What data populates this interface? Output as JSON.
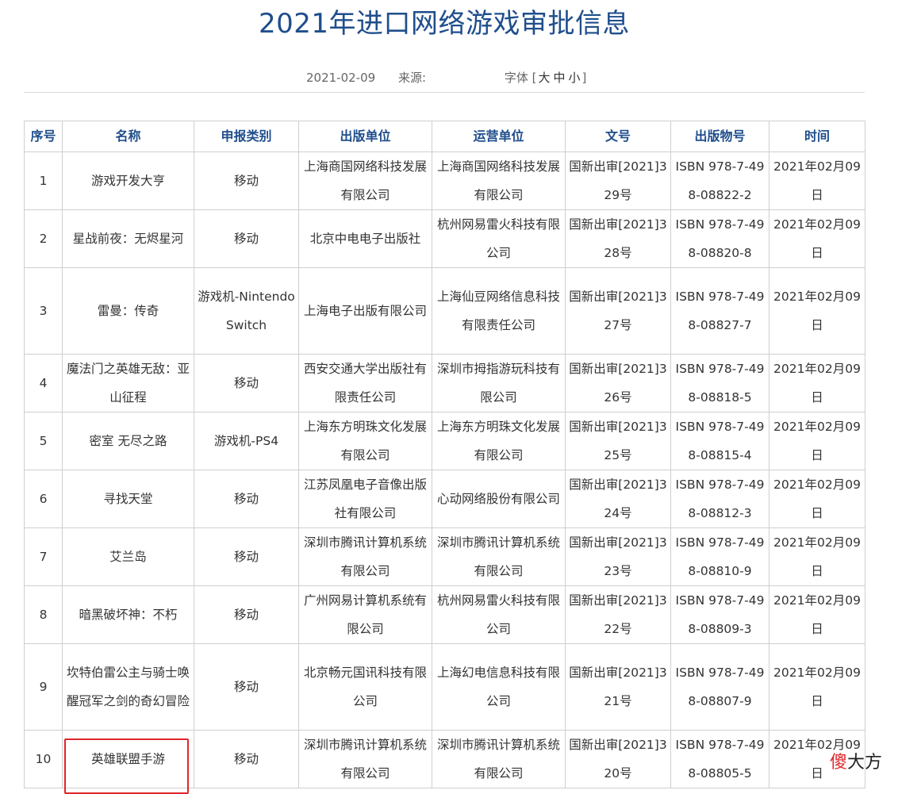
{
  "article": {
    "title": "2021年进口网络游戏审批信息",
    "date": "2021-02-09",
    "source_label": "来源:",
    "font_label": "字体",
    "font_open": "[",
    "font_large": "大",
    "font_medium": "中",
    "font_small": "小",
    "font_close": "]"
  },
  "table": {
    "headers": [
      "序号",
      "名称",
      "申报类别",
      "出版单位",
      "运营单位",
      "文号",
      "出版物号",
      "时间"
    ],
    "rows": [
      {
        "no": "1",
        "name": "游戏开发大亨",
        "category": "移动",
        "publisher": "上海商国网络科技发展有限公司",
        "operator": "上海商国网络科技发展有限公司",
        "doc_no": "国新出审[2021]329号",
        "isbn": "ISBN 978-7-498-08822-2",
        "date": "2021年02月09日"
      },
      {
        "no": "2",
        "name": "星战前夜：无烬星河",
        "category": "移动",
        "publisher": "北京中电电子出版社",
        "operator": "杭州网易雷火科技有限公司",
        "doc_no": "国新出审[2021]328号",
        "isbn": "ISBN 978-7-498-08820-8",
        "date": "2021年02月09日"
      },
      {
        "no": "3",
        "name": "雷曼：传奇",
        "category": "游戏机-Nintendo Switch",
        "publisher": "上海电子出版有限公司",
        "operator": "上海仙豆网络信息科技有限责任公司",
        "doc_no": "国新出审[2021]327号",
        "isbn": "ISBN 978-7-498-08827-7",
        "date": "2021年02月09日"
      },
      {
        "no": "4",
        "name": "魔法门之英雄无敌：亚山征程",
        "category": "移动",
        "publisher": "西安交通大学出版社有限责任公司",
        "operator": "深圳市拇指游玩科技有限公司",
        "doc_no": "国新出审[2021]326号",
        "isbn": "ISBN 978-7-498-08818-5",
        "date": "2021年02月09日"
      },
      {
        "no": "5",
        "name": "密室 无尽之路",
        "category": "游戏机-PS4",
        "publisher": "上海东方明珠文化发展有限公司",
        "operator": "上海东方明珠文化发展有限公司",
        "doc_no": "国新出审[2021]325号",
        "isbn": "ISBN 978-7-498-08815-4",
        "date": "2021年02月09日"
      },
      {
        "no": "6",
        "name": "寻找天堂",
        "category": "移动",
        "publisher": "江苏凤凰电子音像出版社有限公司",
        "operator": "心动网络股份有限公司",
        "doc_no": "国新出审[2021]324号",
        "isbn": "ISBN 978-7-498-08812-3",
        "date": "2021年02月09日"
      },
      {
        "no": "7",
        "name": "艾兰岛",
        "category": "移动",
        "publisher": "深圳市腾讯计算机系统有限公司",
        "operator": "深圳市腾讯计算机系统有限公司",
        "doc_no": "国新出审[2021]323号",
        "isbn": "ISBN 978-7-498-08810-9",
        "date": "2021年02月09日"
      },
      {
        "no": "8",
        "name": "暗黑破坏神：不朽",
        "category": "移动",
        "publisher": "广州网易计算机系统有限公司",
        "operator": "杭州网易雷火科技有限公司",
        "doc_no": "国新出审[2021]322号",
        "isbn": "ISBN 978-7-498-08809-3",
        "date": "2021年02月09日"
      },
      {
        "no": "9",
        "name": "坎特伯雷公主与骑士唤醒冠军之剑的奇幻冒险",
        "category": "移动",
        "publisher": "北京畅元国讯科技有限公司",
        "operator": "上海幻电信息科技有限公司",
        "doc_no": "国新出审[2021]321号",
        "isbn": "ISBN 978-7-498-08807-9",
        "date": "2021年02月09日"
      },
      {
        "no": "10",
        "name": "英雄联盟手游",
        "category": "移动",
        "publisher": "深圳市腾讯计算机系统有限公司",
        "operator": "深圳市腾讯计算机系统有限公司",
        "doc_no": "国新出审[2021]320号",
        "isbn": "ISBN 978-7-498-08805-5",
        "date": "2021年02月09日",
        "highlighted": true
      }
    ]
  },
  "watermark": {
    "red_text": "傻",
    "dark_text": "大方"
  },
  "colors": {
    "title": "#1f4e8c",
    "header_text": "#1f4e8c",
    "highlight_border": "#e0262a",
    "grid": "#cfcfcf"
  }
}
